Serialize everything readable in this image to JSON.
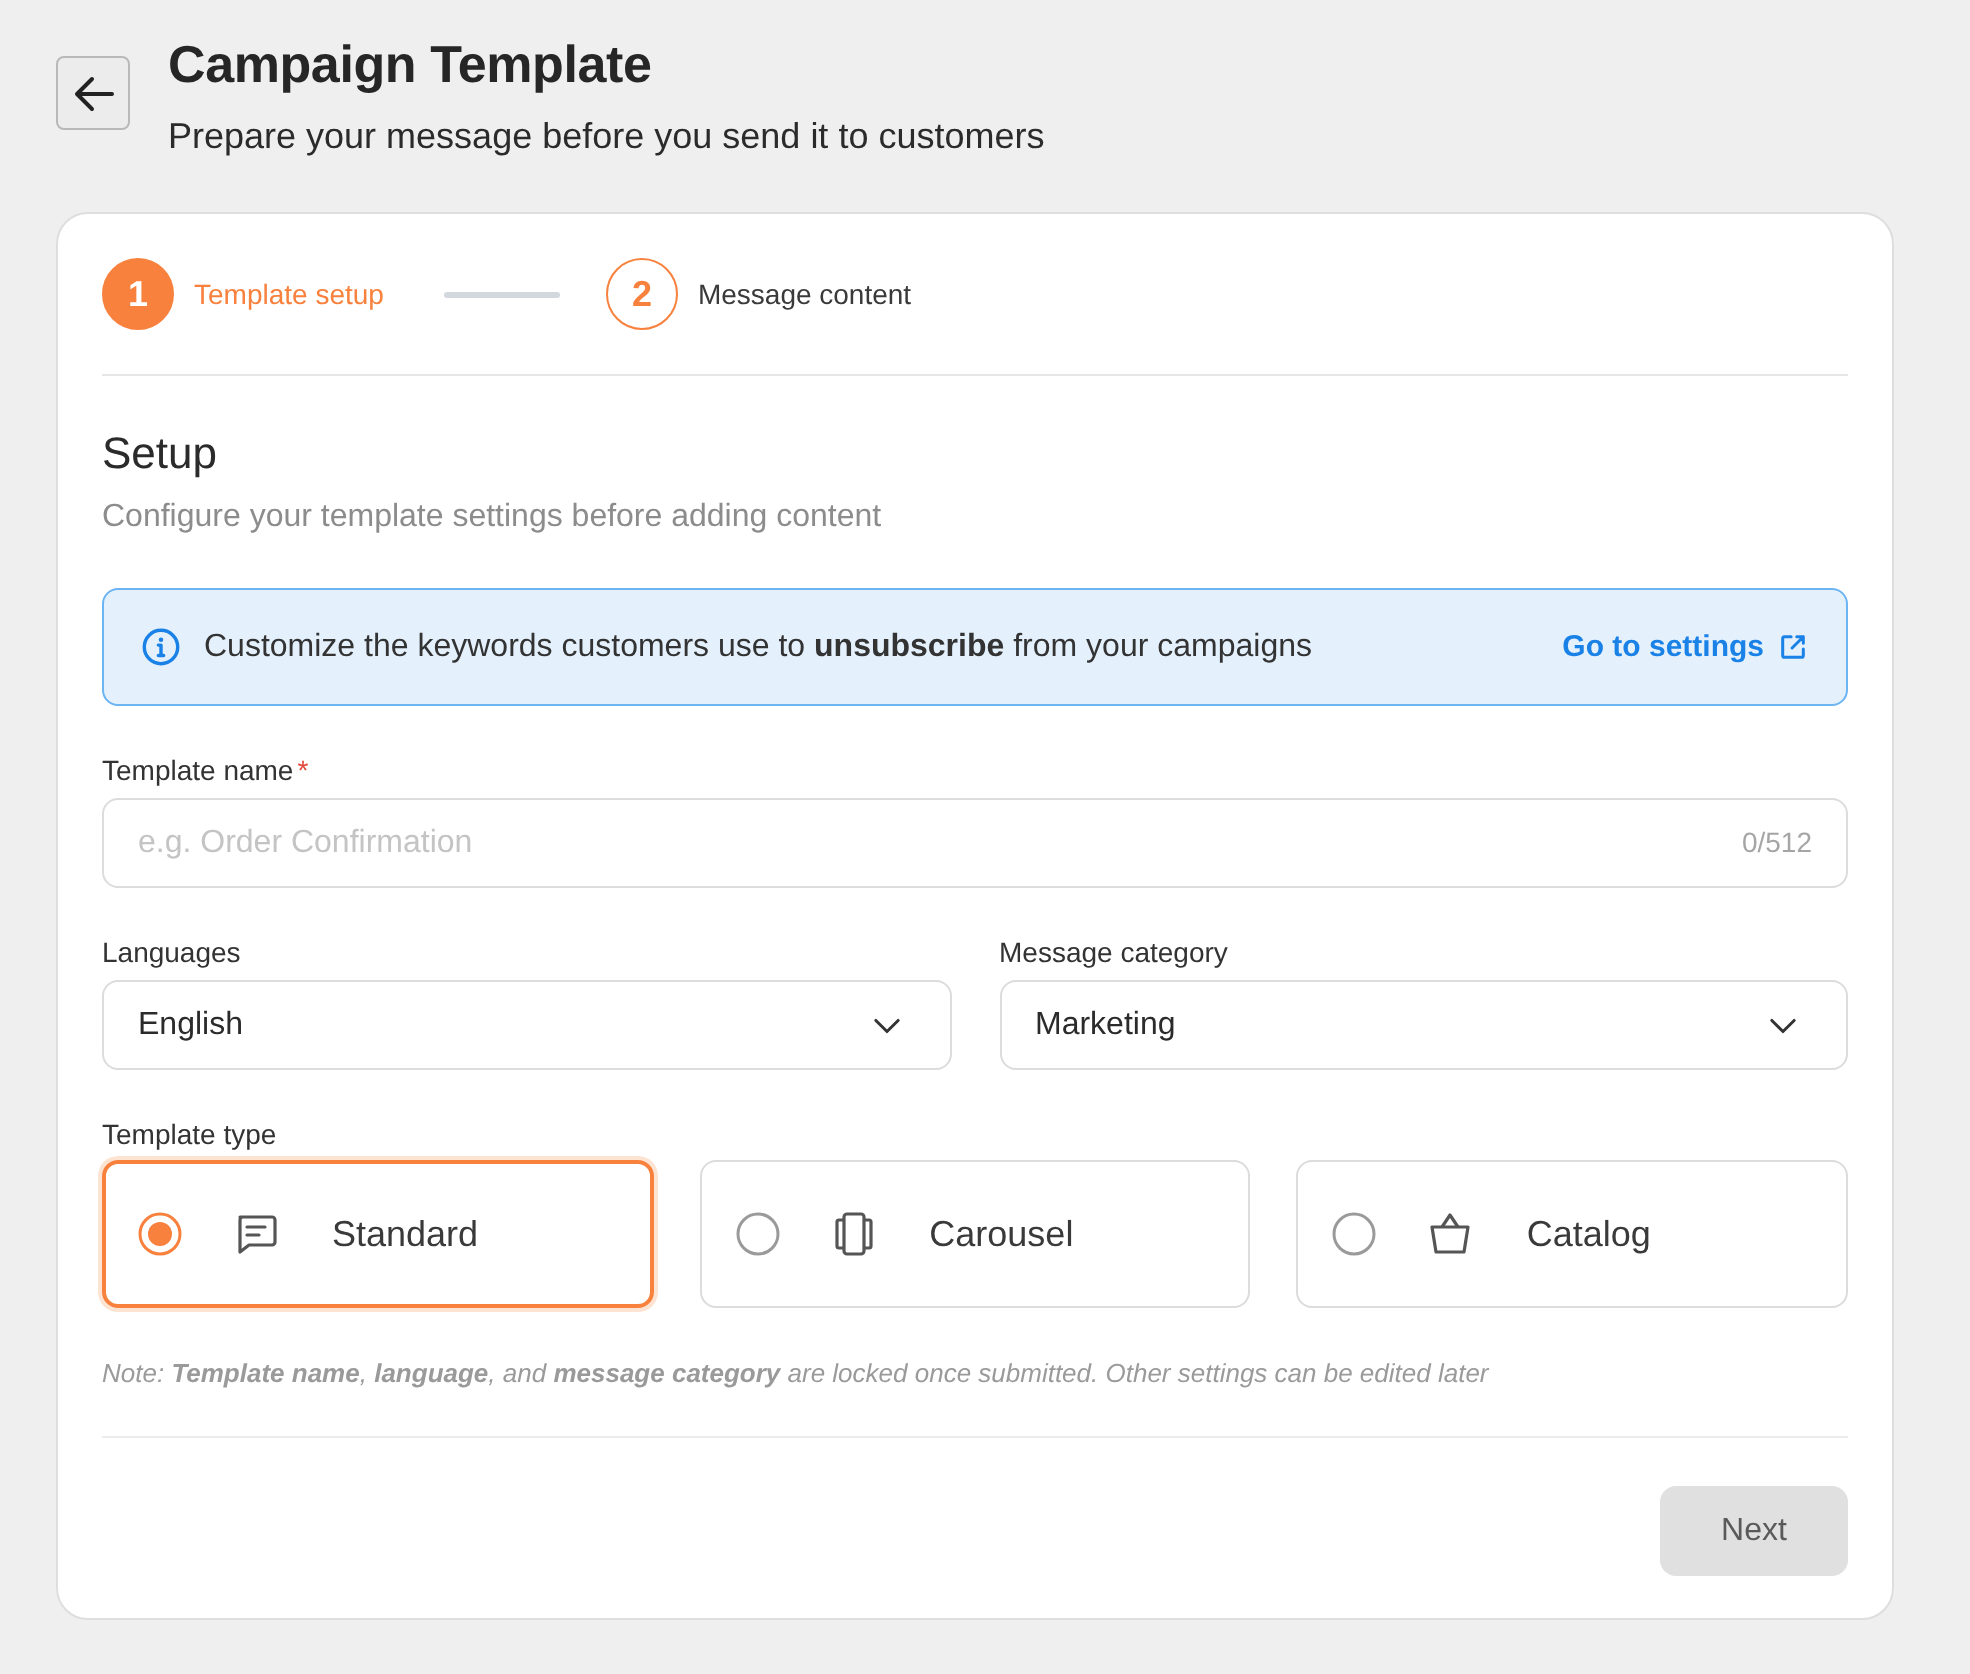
{
  "header": {
    "title": "Campaign Template",
    "subtitle": "Prepare your message before you send it to customers"
  },
  "stepper": [
    {
      "number": "1",
      "label": "Template setup",
      "selected": true
    },
    {
      "number": "2",
      "label": "Message content",
      "selected": false
    }
  ],
  "section": {
    "title": "Setup",
    "subtitle": "Configure your template settings before adding content"
  },
  "banner": {
    "text": "Customize the keywords customers use to **unsubscribe** from your campaigns",
    "link": "Go to settings"
  },
  "template_name": {
    "label": "Template name",
    "required_mark": "*",
    "placeholder": "e.g. Order Confirmation",
    "counter": "0/512"
  },
  "languages": {
    "label": "Languages",
    "value": "English"
  },
  "message_category": {
    "label": "Message category",
    "value": "Marketing"
  },
  "template_type": {
    "label": "Template type",
    "options": [
      {
        "kind": "standard",
        "label": "Standard",
        "selected": true
      },
      {
        "kind": "carousel",
        "label": "Carousel",
        "selected": false
      },
      {
        "kind": "catalog",
        "label": "Catalog",
        "selected": false
      }
    ]
  },
  "note": "Note: **Template name**, **language**, and **message category** are locked once submitted. Other settings can be edited later",
  "next_button": {
    "label": "Next",
    "disabled": true
  }
}
